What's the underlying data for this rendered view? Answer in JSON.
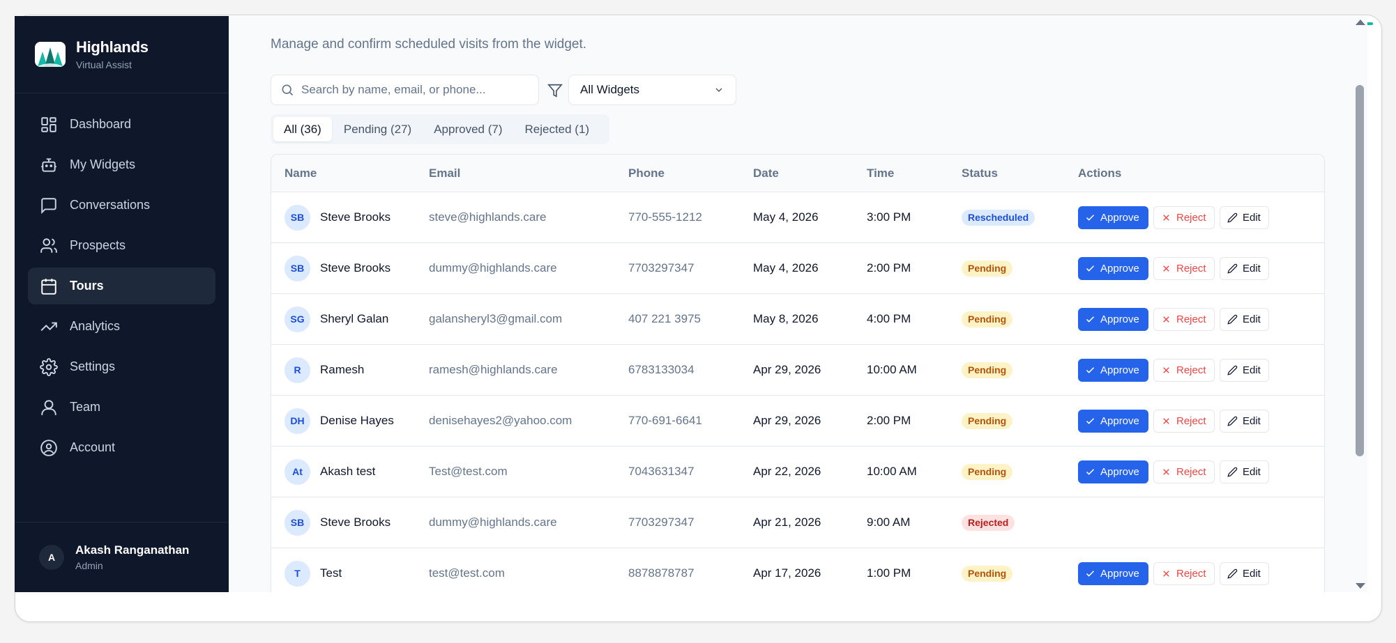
{
  "brand": {
    "title": "Highlands",
    "subtitle": "Virtual Assist"
  },
  "nav": [
    {
      "label": "Dashboard",
      "icon": "dashboard-icon"
    },
    {
      "label": "My Widgets",
      "icon": "bot-icon"
    },
    {
      "label": "Conversations",
      "icon": "chat-icon"
    },
    {
      "label": "Prospects",
      "icon": "users-icon"
    },
    {
      "label": "Tours",
      "icon": "calendar-icon",
      "active": true
    },
    {
      "label": "Analytics",
      "icon": "trend-icon"
    },
    {
      "label": "Settings",
      "icon": "gear-icon"
    },
    {
      "label": "Team",
      "icon": "team-icon"
    },
    {
      "label": "Account",
      "icon": "account-icon"
    }
  ],
  "user": {
    "initial": "A",
    "name": "Akash Ranganathan",
    "role": "Admin"
  },
  "page": {
    "subtitle": "Manage and confirm scheduled visits from the widget."
  },
  "search": {
    "placeholder": "Search by name, email, or phone...",
    "value": ""
  },
  "widget_filter": {
    "selected": "All Widgets"
  },
  "tabs": [
    {
      "label": "All (36)",
      "active": true
    },
    {
      "label": "Pending (27)"
    },
    {
      "label": "Approved (7)"
    },
    {
      "label": "Rejected (1)"
    }
  ],
  "table": {
    "headers": [
      "Name",
      "Email",
      "Phone",
      "Date",
      "Time",
      "Status",
      "Actions"
    ],
    "actions": {
      "approve": "Approve",
      "reject": "Reject",
      "edit": "Edit"
    },
    "rows": [
      {
        "initials": "SB",
        "name": "Steve Brooks",
        "email": "steve@highlands.care",
        "phone": "770-555-1212",
        "date": "May 4, 2026",
        "time": "3:00 PM",
        "status": "Rescheduled",
        "status_kind": "rescheduled",
        "has_actions": true
      },
      {
        "initials": "SB",
        "name": "Steve Brooks",
        "email": "dummy@highlands.care",
        "phone": "7703297347",
        "date": "May 4, 2026",
        "time": "2:00 PM",
        "status": "Pending",
        "status_kind": "pending",
        "has_actions": true
      },
      {
        "initials": "SG",
        "name": "Sheryl Galan",
        "email": "galansheryl3@gmail.com",
        "phone": "407 221 3975",
        "date": "May 8, 2026",
        "time": "4:00 PM",
        "status": "Pending",
        "status_kind": "pending",
        "has_actions": true
      },
      {
        "initials": "R",
        "name": "Ramesh",
        "email": "ramesh@highlands.care",
        "phone": "6783133034",
        "date": "Apr 29, 2026",
        "time": "10:00 AM",
        "status": "Pending",
        "status_kind": "pending",
        "has_actions": true
      },
      {
        "initials": "DH",
        "name": "Denise Hayes",
        "email": "denisehayes2@yahoo.com",
        "phone": "770-691-6641",
        "date": "Apr 29, 2026",
        "time": "2:00 PM",
        "status": "Pending",
        "status_kind": "pending",
        "has_actions": true
      },
      {
        "initials": "At",
        "name": "Akash test",
        "email": "Test@test.com",
        "phone": "7043631347",
        "date": "Apr 22, 2026",
        "time": "10:00 AM",
        "status": "Pending",
        "status_kind": "pending",
        "has_actions": true
      },
      {
        "initials": "SB",
        "name": "Steve Brooks",
        "email": "dummy@highlands.care",
        "phone": "7703297347",
        "date": "Apr 21, 2026",
        "time": "9:00 AM",
        "status": "Rejected",
        "status_kind": "rejected",
        "has_actions": false
      },
      {
        "initials": "T",
        "name": "Test",
        "email": "test@test.com",
        "phone": "8878878787",
        "date": "Apr 17, 2026",
        "time": "1:00 PM",
        "status": "Pending",
        "status_kind": "pending",
        "has_actions": true
      }
    ]
  },
  "colors": {
    "accent": "#2563eb",
    "sidebar": "#0f172a",
    "topline": "#14b8a6"
  }
}
